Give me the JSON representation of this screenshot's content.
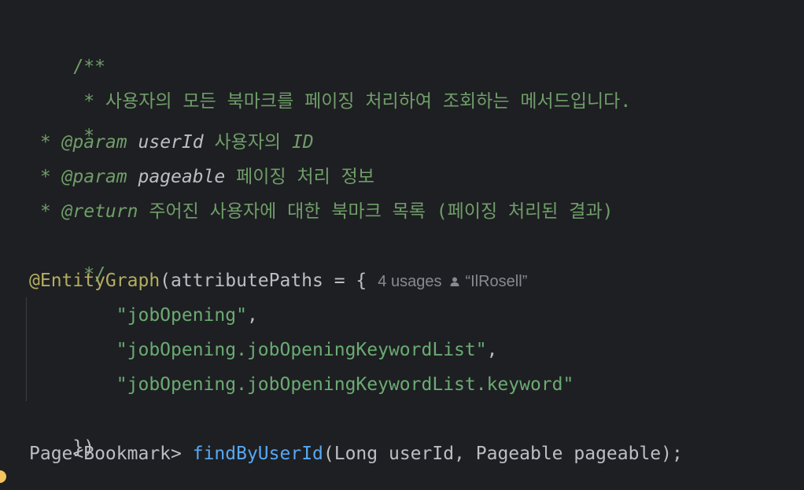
{
  "code": {
    "doc_open": "/**",
    "doc_desc": " * 사용자의 모든 북마크를 페이징 처리하여 조회하는 메서드입니다.",
    "doc_blank": " *",
    "param1": {
      "prefix": " * ",
      "tag": "@param",
      "name": "userId",
      "text": " 사용자의 ",
      "ref": "ID"
    },
    "param2": {
      "prefix": " * ",
      "tag": "@param",
      "name": "pageable",
      "text": " 페이징 처리 정보"
    },
    "ret": {
      "prefix": " * ",
      "tag": "@return",
      "text": " 주어진 사용자에 대한 북마크 목록 (페이징 처리된 결과)"
    },
    "doc_close": " */",
    "annotation": "@EntityGraph",
    "annotation_args": "(attributePaths = {",
    "inlay_hint": {
      "usages": "4 usages",
      "author": "“IlRosell”"
    },
    "strings": [
      "\"jobOpening\"",
      "\"jobOpening.jobOpeningKeywordList\"",
      "\"jobOpening.jobOpeningKeywordList.keyword\""
    ],
    "string_indent": "        ",
    "comma": ",",
    "close": "})",
    "sig_type": "Page<Bookmark> ",
    "sig_method": "findByUserId",
    "sig_params": "(Long userId, Pageable pageable);"
  },
  "colors": {
    "background": "#1e1f22",
    "comment": "#6f9e69",
    "annotation": "#b3ae60",
    "string": "#6aab73",
    "method": "#56a8f5",
    "text": "#bcbec4"
  }
}
